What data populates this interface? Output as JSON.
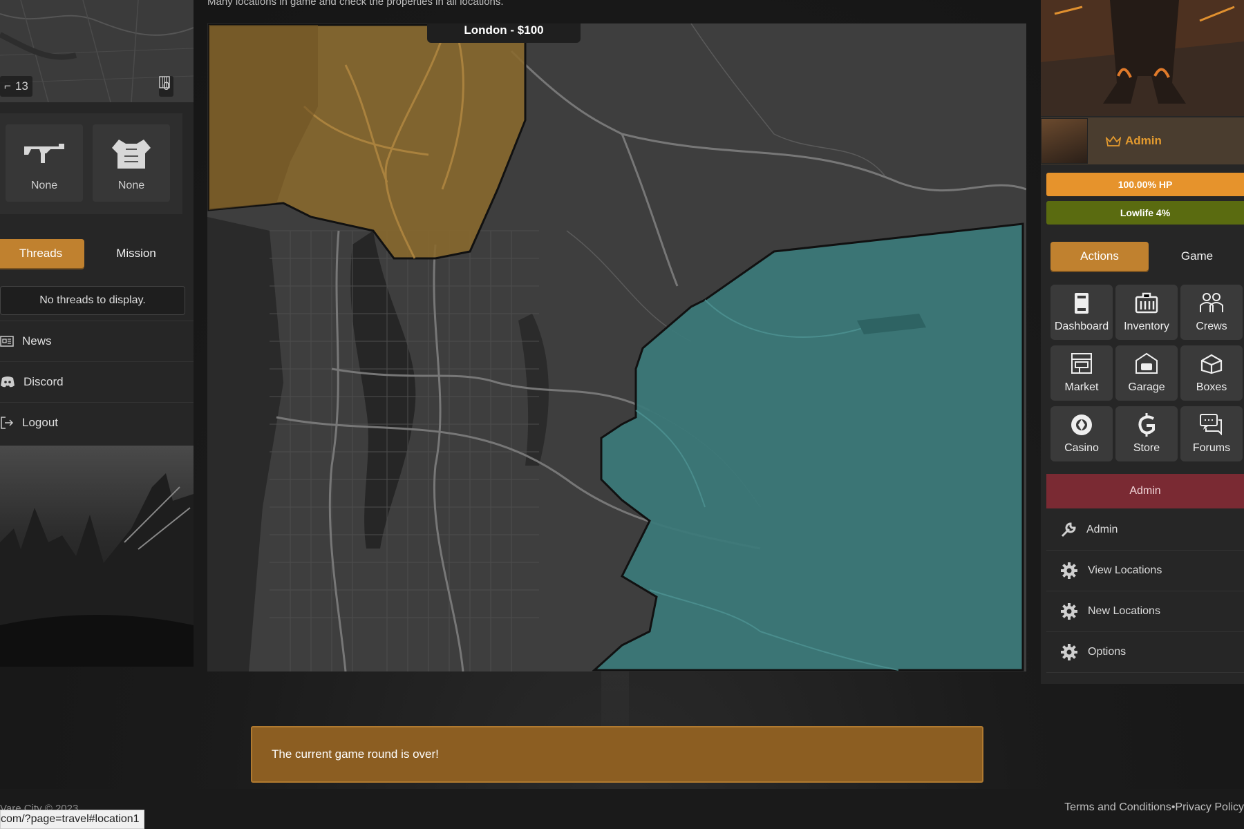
{
  "left": {
    "stats": [
      {
        "icon": "gun-icon",
        "value": "13"
      },
      {
        "icon": "jail-icon",
        "value": "0"
      }
    ],
    "equipment": [
      {
        "slot": "weapon",
        "icon": "gun-icon",
        "label": "None"
      },
      {
        "slot": "armor",
        "icon": "armor-icon",
        "label": "None"
      }
    ],
    "tabs": [
      "Threads",
      "Mission"
    ],
    "threads_empty": "No threads to display.",
    "nav": [
      {
        "icon": "news-icon",
        "label": "News"
      },
      {
        "icon": "discord-icon",
        "label": "Discord"
      },
      {
        "icon": "logout-icon",
        "label": "Logout"
      }
    ]
  },
  "main": {
    "intro": "Many locations in game and check the properties in all locations.",
    "tooltip": "London - $100",
    "alert": "The current game round is over!"
  },
  "right": {
    "rank": "Admin",
    "hp_label": "100.00% HP",
    "hp_fraction": 1.0,
    "level_label": "Lowlife 4%",
    "level_fraction": 0.04,
    "tabs": [
      "Actions",
      "Game"
    ],
    "tiles": [
      {
        "icon": "dashboard-icon",
        "label": "Dashboard"
      },
      {
        "icon": "inventory-icon",
        "label": "Inventory"
      },
      {
        "icon": "crews-icon",
        "label": "Crews"
      },
      {
        "icon": "market-icon",
        "label": "Market"
      },
      {
        "icon": "garage-icon",
        "label": "Garage"
      },
      {
        "icon": "boxes-icon",
        "label": "Boxes"
      },
      {
        "icon": "casino-icon",
        "label": "Casino"
      },
      {
        "icon": "store-icon",
        "label": "Store"
      },
      {
        "icon": "forums-icon",
        "label": "Forums"
      }
    ],
    "admin_header": "Admin",
    "admin_items": [
      {
        "icon": "wrench-icon",
        "label": "Admin"
      },
      {
        "icon": "gear-icon",
        "label": "View Locations"
      },
      {
        "icon": "gear-icon",
        "label": "New Locations"
      },
      {
        "icon": "gear-icon",
        "label": "Options"
      }
    ]
  },
  "footer": {
    "copyright": "Vare City © 2023",
    "terms": "Terms and Conditions",
    "separator": "•",
    "privacy": "Privacy Policy"
  },
  "statusbar": "com/?page=travel#location1",
  "colors": {
    "accent": "#c0812f",
    "zone_london": "#8a6a2e",
    "zone_east": "#3b7a7a",
    "admin_red": "#7a2a33",
    "hp_orange": "#e6932c",
    "level_olive": "#5a6b10"
  }
}
